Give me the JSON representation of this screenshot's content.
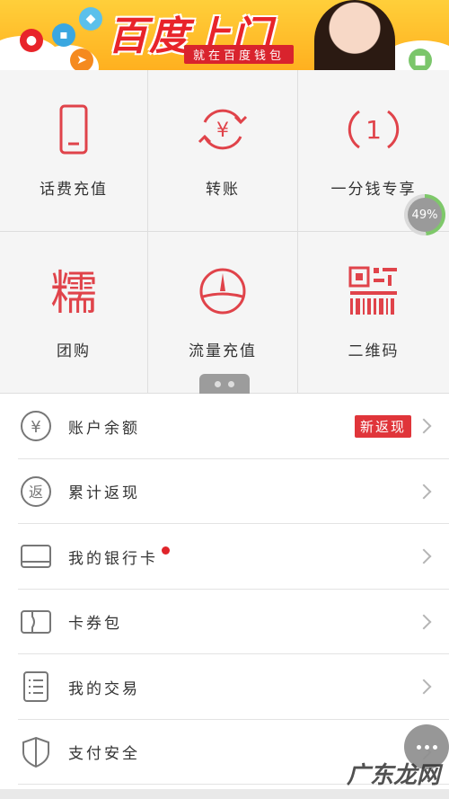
{
  "banner": {
    "title": "百度上门",
    "subtitle": "就在百度钱包"
  },
  "grid": {
    "items": [
      {
        "label": "话费充值",
        "icon": "phone-icon"
      },
      {
        "label": "转账",
        "icon": "transfer-icon"
      },
      {
        "label": "一分钱专享",
        "icon": "one-cent-icon"
      },
      {
        "label": "团购",
        "icon": "group-buy-icon"
      },
      {
        "label": "流量充值",
        "icon": "data-gauge-icon"
      },
      {
        "label": "二维码",
        "icon": "qrcode-icon"
      }
    ]
  },
  "progress": {
    "text": "49%",
    "value": 0.49
  },
  "pager": {
    "pages": 2,
    "current": 1
  },
  "list": {
    "items": [
      {
        "label": "账户余额",
        "icon": "yuan-icon",
        "badge": "新返现"
      },
      {
        "label": "累计返现",
        "icon": "cashback-icon"
      },
      {
        "label": "我的银行卡",
        "icon": "bank-card-icon",
        "has_dot": true
      },
      {
        "label": "卡券包",
        "icon": "coupon-icon"
      },
      {
        "label": "我的交易",
        "icon": "transactions-icon"
      },
      {
        "label": "支付安全",
        "icon": "shield-icon"
      }
    ]
  },
  "watermark": "广东龙网",
  "colors": {
    "accent": "#e0353a",
    "banner": "#ffc02a",
    "icon_red": "#e0434a",
    "icon_gray": "#666666"
  }
}
